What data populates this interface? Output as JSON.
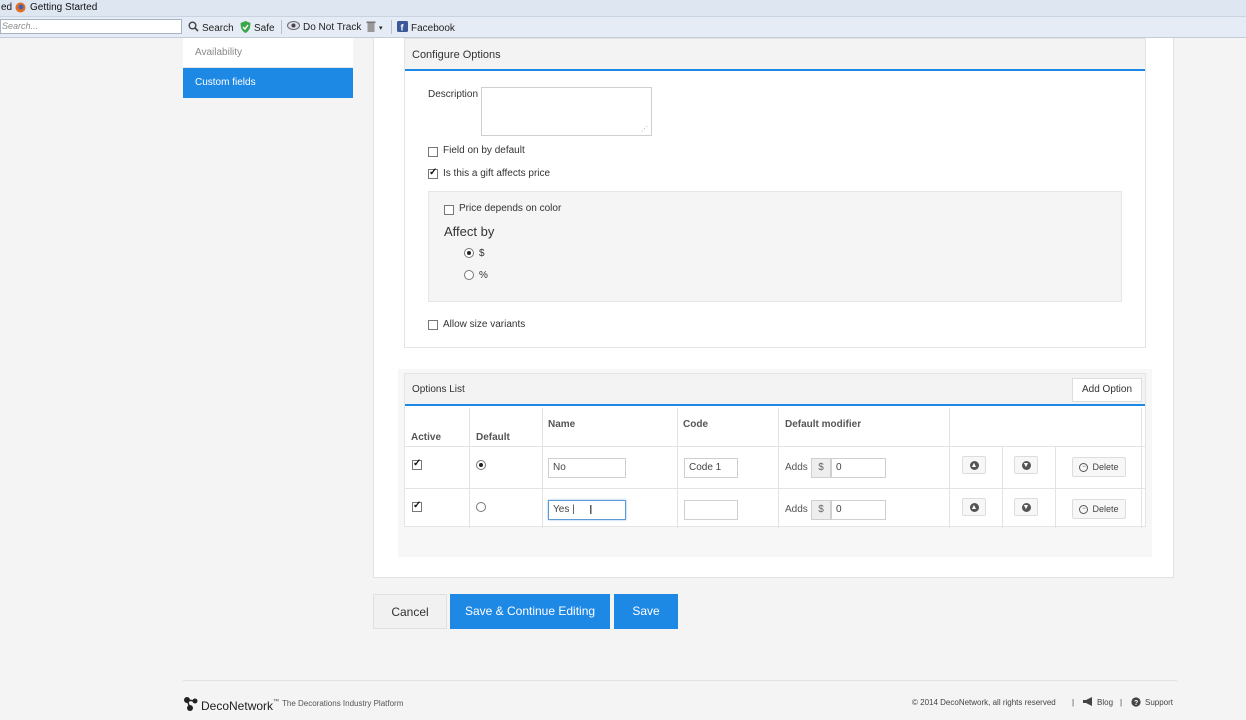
{
  "browser": {
    "bookmarks": {
      "prefix": "ed",
      "getting_started": "Getting Started"
    },
    "toolbar": {
      "search_placeholder": "Search...",
      "search": "Search",
      "safe": "Safe",
      "do_not_track": "Do Not Track",
      "facebook": "Facebook"
    }
  },
  "sidebar": {
    "items": [
      {
        "label": "Availability"
      },
      {
        "label": "Custom fields"
      }
    ]
  },
  "configure": {
    "title": "Configure Options",
    "description_label": "Description",
    "description_value": "",
    "field_on_by_default": "Field on by default",
    "field_on_by_default_checked": false,
    "gift_affects_price": "Is this a gift affects price",
    "gift_affects_price_checked": true,
    "price_depends_on_color": "Price depends on color",
    "price_depends_on_color_checked": false,
    "affect_by_title": "Affect by",
    "affect_options": [
      "$",
      "%"
    ],
    "affect_selected": "$",
    "allow_size_variants": "Allow size variants",
    "allow_size_variants_checked": false
  },
  "options_list": {
    "title": "Options List",
    "add_option": "Add Option",
    "columns": {
      "active": "Active",
      "default": "Default",
      "name": "Name",
      "code": "Code",
      "default_modifier": "Default modifier"
    },
    "adds_label": "Adds",
    "currency": "$",
    "delete_label": "Delete",
    "rows": [
      {
        "active": true,
        "default": true,
        "name": "No",
        "code": "Code 1",
        "modifier": "0"
      },
      {
        "active": true,
        "default": false,
        "name": "Yes |",
        "code": "",
        "modifier": "0"
      }
    ]
  },
  "actions": {
    "cancel": "Cancel",
    "save_continue": "Save & Continue Editing",
    "save": "Save"
  },
  "footer": {
    "brand": "DecoNetwork",
    "trademark": "™",
    "tagline": "The Decorations Industry Platform",
    "copyright": "© 2014 DecoNetwork, all rights reserved",
    "blog": "Blog",
    "support": "Support",
    "separator": "|"
  },
  "colors": {
    "accent": "#1e88e5"
  }
}
